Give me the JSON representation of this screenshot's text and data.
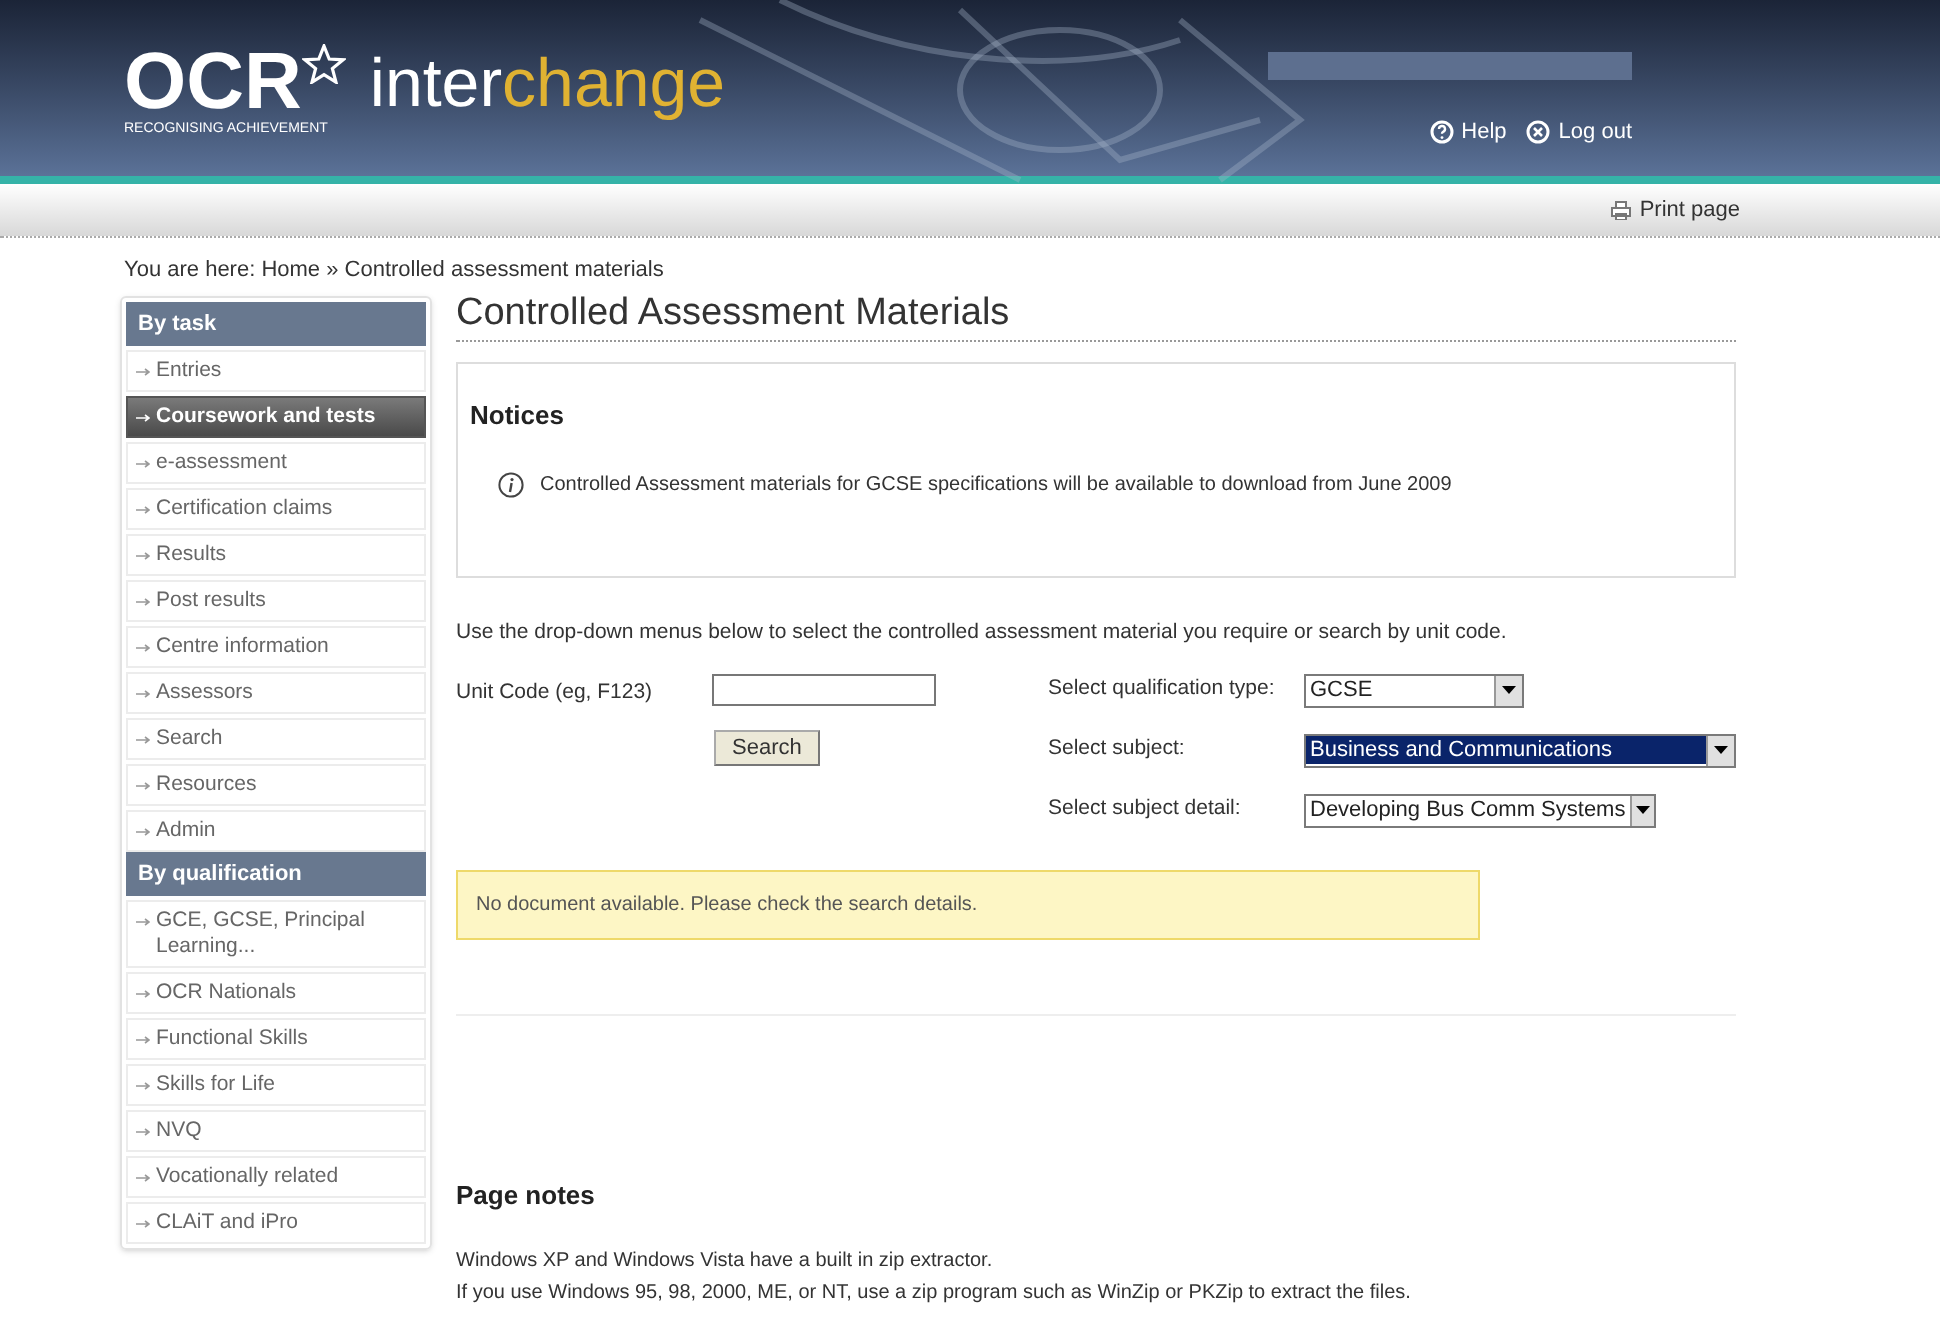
{
  "header": {
    "logo": {
      "wordmark": "OCR",
      "tagline": "RECOGNISING ACHIEVEMENT"
    },
    "app_name": {
      "part_1": "inter",
      "part_2": "change"
    },
    "links": [
      {
        "kind": "help",
        "label": "Help"
      },
      {
        "kind": "logout",
        "label": "Log out"
      }
    ]
  },
  "toolbar": {
    "print_label": "Print page"
  },
  "breadcrumb": "You are here: Home » Controlled assessment materials",
  "sidebar": {
    "sections": [
      {
        "heading": "By task",
        "items": [
          {
            "label": "Entries",
            "selected": false
          },
          {
            "label": "Coursework and tests",
            "selected": true
          },
          {
            "label": "e-assessment",
            "selected": false
          },
          {
            "label": "Certification claims",
            "selected": false
          },
          {
            "label": "Results",
            "selected": false
          },
          {
            "label": "Post results",
            "selected": false
          },
          {
            "label": "Centre information",
            "selected": false
          },
          {
            "label": "Assessors",
            "selected": false
          },
          {
            "label": "Search",
            "selected": false
          },
          {
            "label": "Resources",
            "selected": false
          },
          {
            "label": "Admin",
            "selected": false
          }
        ]
      },
      {
        "heading": "By qualification",
        "items": [
          {
            "label": "GCE, GCSE, Principal Learning...",
            "selected": false
          },
          {
            "label": "OCR Nationals",
            "selected": false
          },
          {
            "label": "Functional Skills",
            "selected": false
          },
          {
            "label": "Skills for Life",
            "selected": false
          },
          {
            "label": "NVQ",
            "selected": false
          },
          {
            "label": "Vocationally related",
            "selected": false
          },
          {
            "label": "CLAiT and iPro",
            "selected": false
          }
        ]
      }
    ]
  },
  "page_title": "Controlled Assessment Materials",
  "notices": {
    "heading": "Notices",
    "items": [
      "Controlled Assessment materials for GCSE specifications will be available to download from June 2009"
    ]
  },
  "instructions": "Use the drop-down menus below to select the controlled assessment material you require or search by unit code.",
  "unit_code": {
    "label": "Unit Code (eg, F123)",
    "button": "Search"
  },
  "selects": [
    {
      "label": "Select qualification type:",
      "value": "GCSE",
      "focused": false
    },
    {
      "label": "Select subject:",
      "value": "Business and Communications",
      "focused": true
    },
    {
      "label": "Select subject detail:",
      "value": "Developing Bus Comm Systems",
      "focused": false
    }
  ],
  "message": "No document available. Please check the search details.",
  "page_notes": {
    "heading": "Page notes",
    "lines": [
      "Windows XP and Windows Vista have a built in zip extractor.",
      "If you use Windows 95, 98, 2000, ME, or NT, use a zip program such as WinZip or PKZip to extract the files."
    ]
  }
}
